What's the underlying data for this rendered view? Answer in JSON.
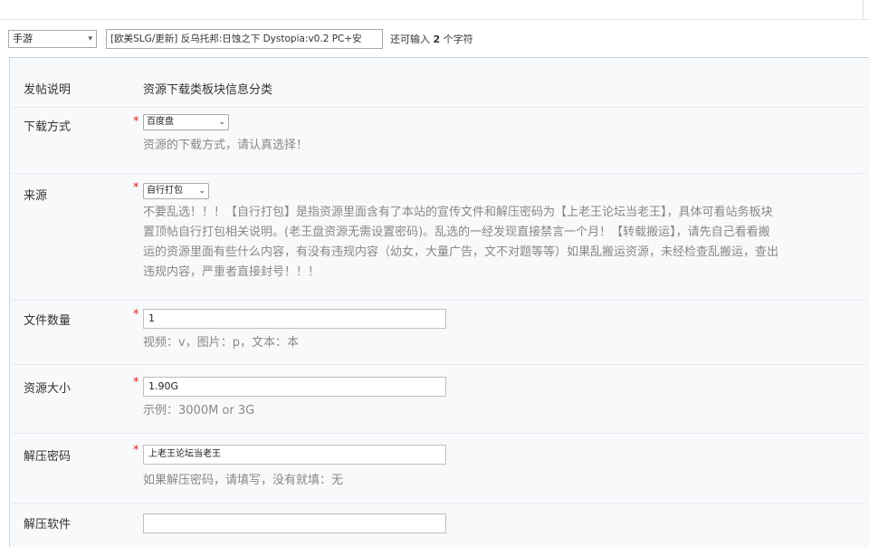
{
  "title_row": {
    "type_select": "手游",
    "title_value": "[欧美SLG/更新] 反乌托邦:日蚀之下 Dystopia:v0.2 PC+安",
    "hint_prefix": "还可输入",
    "hint_count": "2",
    "hint_suffix": "个字符"
  },
  "rows": {
    "notice": {
      "label": "发帖说明",
      "value": "资源下载类板块信息分类"
    },
    "download": {
      "label": "下载方式",
      "star": "*",
      "selected": "百度盘",
      "desc": "资源的下载方式，请认真选择！"
    },
    "source": {
      "label": "来源",
      "star": "*",
      "selected": "自行打包",
      "desc_lines": [
        "不要乱选！！！【自行打包】是指资源里面含有了本站的宣传文件和解压密码为【上老王论坛当老王】，具体可看站务板块",
        "置顶帖自行打包相关说明。(老王盘资源无需设置密码)。乱选的一经发现直接禁言一个月！【转载搬运】，请先自己看看搬",
        "运的资源里面有些什么内容，有没有违规内容（幼女，大量广告，文不对题等等）如果乱搬运资源，未经检查乱搬运，查出",
        "违规内容，严重者直接封号！！！"
      ]
    },
    "file_count": {
      "label": "文件数量",
      "star": "*",
      "value": "1",
      "desc": "视频：v，图片：p，文本：本"
    },
    "size": {
      "label": "资源大小",
      "star": "*",
      "value": "1.90G",
      "desc": "示例：3000M or 3G"
    },
    "password": {
      "label": "解压密码",
      "star": "*",
      "value": "上老王论坛当老王",
      "desc": "如果解压密码，请填写，没有就填：无"
    },
    "software": {
      "label": "解压软件"
    }
  }
}
